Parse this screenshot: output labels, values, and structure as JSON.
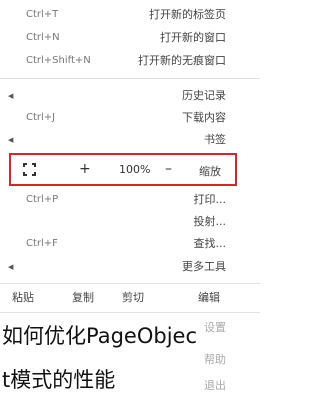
{
  "menu": {
    "items": [
      {
        "label": "打开新的标签页",
        "shortcut": "Ctrl+T"
      },
      {
        "label": "打开新的窗口",
        "shortcut": "Ctrl+N"
      },
      {
        "label": "打开新的无痕窗口",
        "shortcut": "Ctrl+Shift+N"
      },
      {
        "label": "历史记录",
        "shortcut": ""
      },
      {
        "label": "下载内容",
        "shortcut": "Ctrl+J"
      },
      {
        "label": "书签",
        "shortcut": ""
      },
      {
        "label": "打印...",
        "shortcut": "Ctrl+P"
      },
      {
        "label": "投射...",
        "shortcut": ""
      },
      {
        "label": "查找...",
        "shortcut": "Ctrl+F"
      },
      {
        "label": "更多工具",
        "shortcut": ""
      }
    ],
    "zoom": {
      "label": "缩放",
      "value": "100%",
      "plus": "+",
      "minus": "–"
    },
    "edit": {
      "label": "编辑",
      "cut": "剪切",
      "copy": "复制",
      "paste": "粘贴"
    },
    "settings": "设置",
    "help": "帮助",
    "exit": "退出"
  },
  "overlay": {
    "line1": "如何优化PageObjec",
    "line2": "t模式的性能"
  }
}
